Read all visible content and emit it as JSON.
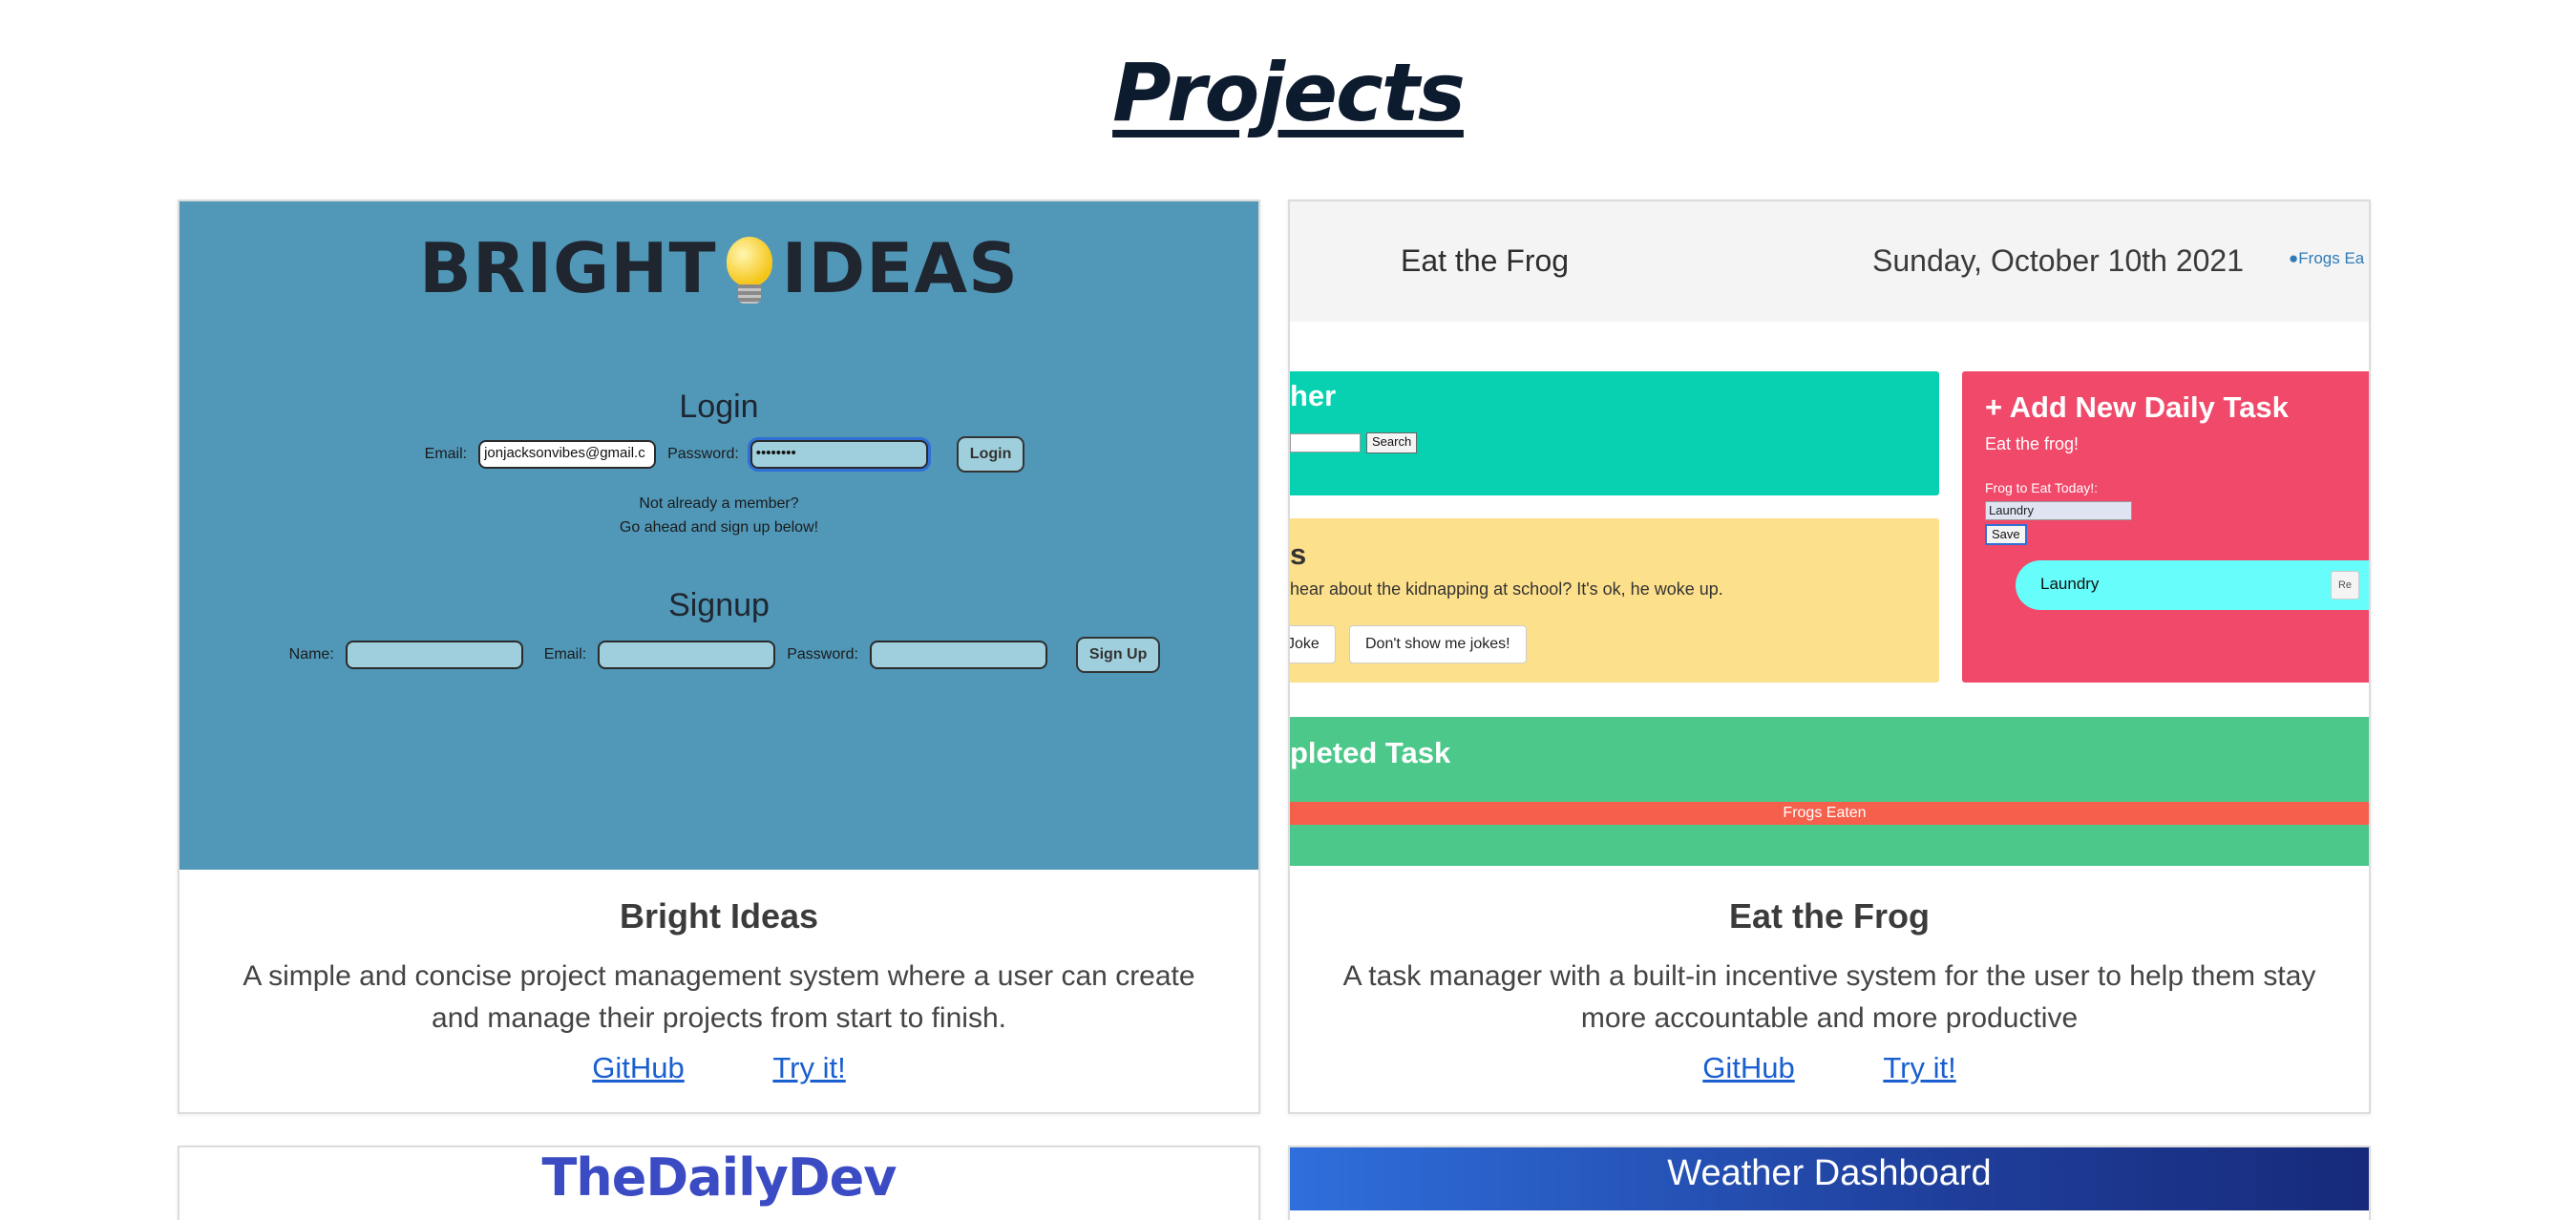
{
  "page": {
    "title": "Projects"
  },
  "colors": {
    "link": "#1a5fd0",
    "bright_ideas_bg": "#5198b8",
    "frog_red": "#f0496a",
    "frog_teal": "#07d1b1",
    "frog_yellow": "#fde08c",
    "frog_green": "#4cc88a"
  },
  "projects": [
    {
      "title": "Bright Ideas",
      "description": "A simple and concise project management system where a user can create and manage their projects from start to finish.",
      "github_label": "GitHub",
      "try_label": "Try it!",
      "preview": {
        "logo_left": "BRIGHT",
        "logo_right": "IDEAS",
        "login_heading": "Login",
        "email_label": "Email:",
        "email_value": "jonjacksonvibes@gmail.c",
        "password_label": "Password:",
        "password_value": "••••••••",
        "login_button": "Login",
        "note_line1": "Not already a member?",
        "note_line2": "Go ahead and sign up below!",
        "signup_heading": "Signup",
        "name_label": "Name:",
        "signup_email_label": "Email:",
        "signup_password_label": "Password:",
        "signup_button": "Sign Up"
      }
    },
    {
      "title": "Eat the Frog",
      "description": "A task manager with a built-in incentive system for the user to help them stay more accountable and more productive",
      "github_label": "GitHub",
      "try_label": "Try it!",
      "preview": {
        "app_name": "Eat the Frog",
        "date": "Sunday, October 10th 2021",
        "frogs_link": "Frogs Ea",
        "weather_title": "her",
        "search_button": "Search",
        "joke_title": "s",
        "joke_text": "hear about the kidnapping at school? It's ok, he woke up.",
        "joke_button": "Joke",
        "no_jokes_button": "Don't show me jokes!",
        "add_task_title": "+ Add New Daily Task",
        "add_task_subtitle": "Eat the frog!",
        "frog_label": "Frog to Eat Today!:",
        "frog_value": "Laundry",
        "save_button": "Save",
        "task_item": "Laundry",
        "remove_button": "Re",
        "completed_title": "pleted Task",
        "frogs_eaten_bar": "Frogs Eaten"
      }
    },
    {
      "preview": {
        "logo": "TheDailyDev"
      }
    },
    {
      "preview": {
        "title": "Weather Dashboard"
      }
    }
  ]
}
